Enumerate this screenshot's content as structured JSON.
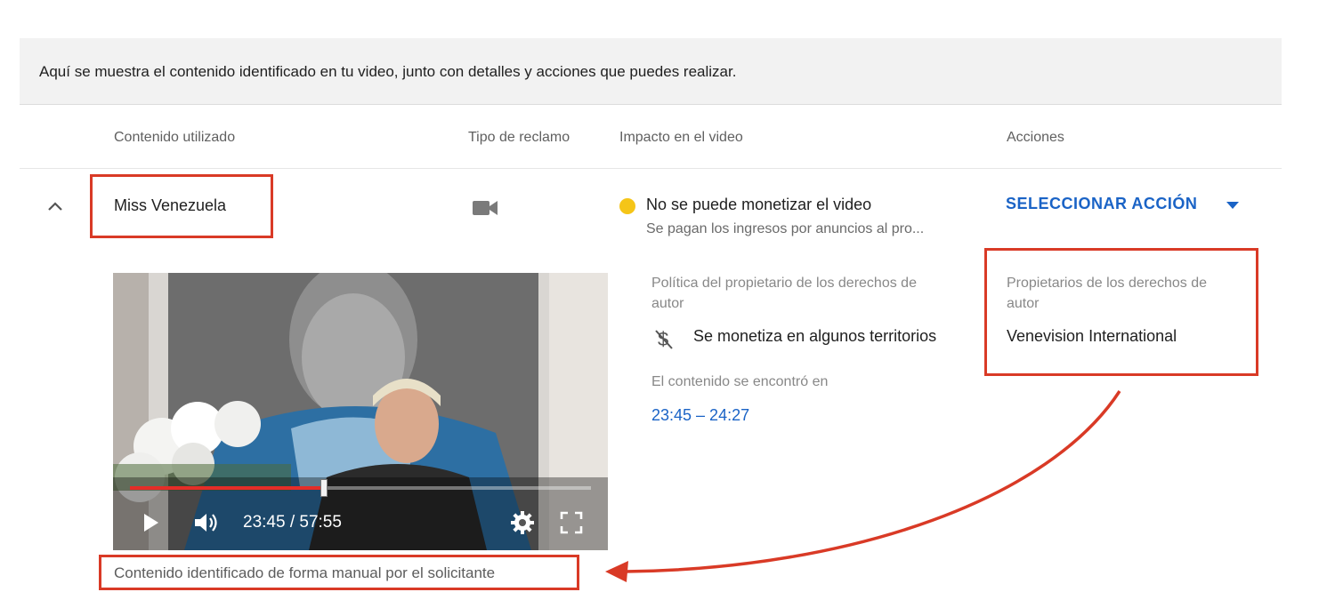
{
  "banner": {
    "text": "Aquí se muestra el contenido identificado en tu video, junto con detalles y acciones que puedes realizar."
  },
  "table": {
    "headers": {
      "content": "Contenido utilizado",
      "claim_type": "Tipo de reclamo",
      "impact": "Impacto en el video",
      "actions": "Acciones"
    }
  },
  "claim": {
    "content_name": "Miss Venezuela",
    "claim_type_icon": "video-camera-icon",
    "impact_title": "No se puede monetizar el video",
    "impact_subtitle": "Se pagan los ingresos por anuncios al pro...",
    "impact_status_color": "#f5c518",
    "action_label": "SELECCIONAR ACCIÓN",
    "policy_label_line1": "Política del propietario de los derechos de",
    "policy_label_line2": "autor",
    "policy_value": "Se monetiza en algunos territorios",
    "found_label": "El contenido se encontró en",
    "found_range": "23:45 – 24:27",
    "owners_label_line1": "Propietarios de los derechos de",
    "owners_label_line2": "autor",
    "owners_value": "Venevision International",
    "identification_note": "Contenido identificado de forma manual por el solicitante"
  },
  "player": {
    "time_display": "23:45 / 57:55",
    "progress_fraction": 0.42
  },
  "colors": {
    "accent_blue": "#1a63c6",
    "annotation_red": "#d93a26",
    "progress_red": "#e52d27"
  }
}
